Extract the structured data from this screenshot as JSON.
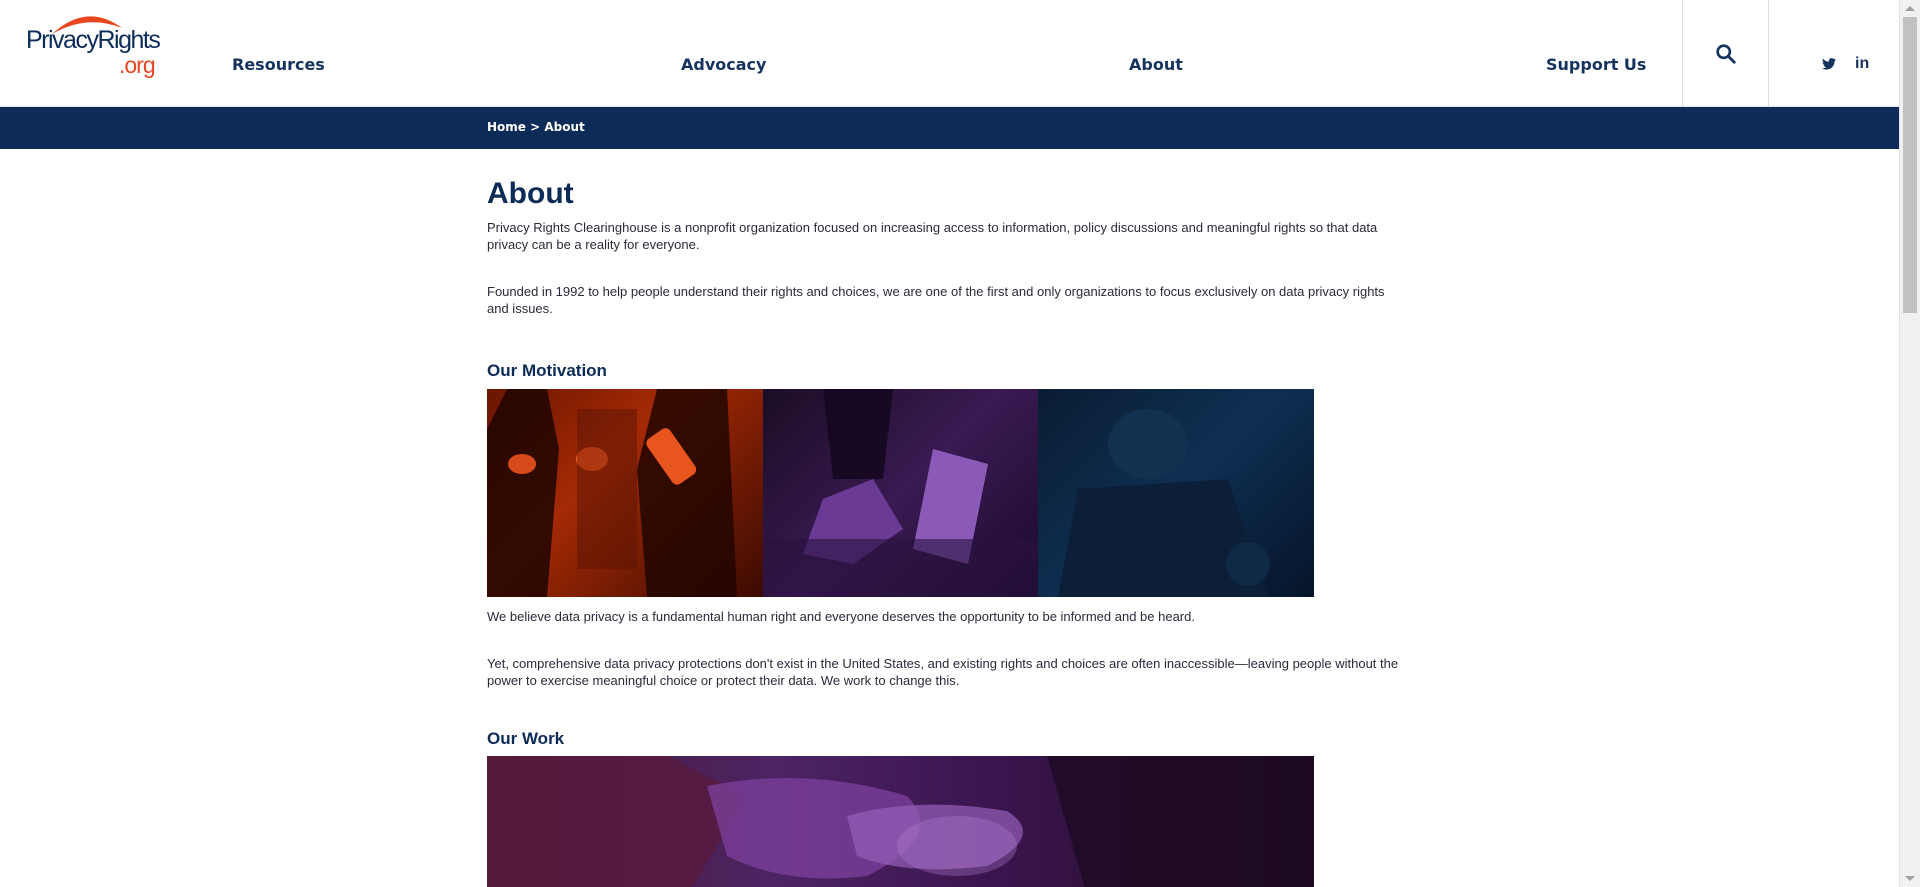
{
  "header": {
    "logo_text_main": "PrivacyRights",
    "logo_text_suffix": ".org",
    "nav": {
      "resources": "Resources",
      "advocacy": "Advocacy",
      "about": "About",
      "support": "Support Us"
    },
    "icons": {
      "search": "search-icon",
      "twitter": "twitter-icon",
      "linkedin": "in"
    }
  },
  "breadcrumb": {
    "home": "Home",
    "separator": " > ",
    "current": "About"
  },
  "main": {
    "title": "About",
    "paragraphs": [
      "Privacy Rights Clearinghouse is a nonprofit organization focused on increasing access to information, policy discussions and meaningful rights so that data privacy can be a reality for everyone.",
      "Founded in 1992 to help people understand their rights and choices, we are one of the first and only organizations to focus exclusively on data privacy rights and issues."
    ],
    "motivation": {
      "heading": "Our Motivation",
      "paragraphs": [
        "We believe data privacy is a fundamental human right and everyone deserves the opportunity to be informed and be heard.",
        "Yet, comprehensive data privacy protections don't exist in the United States, and existing rights and choices are often inaccessible—leaving people without the power to exercise meaningful choice or protect their data. We work to change this."
      ]
    },
    "work": {
      "heading": "Our Work"
    }
  },
  "colors": {
    "navy": "#0d2b57",
    "orange": "#e8461f",
    "text": "#2a2a3a"
  }
}
